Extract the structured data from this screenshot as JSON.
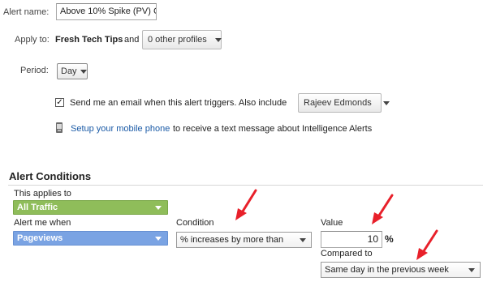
{
  "alert_name": {
    "label": "Alert name:",
    "value": "Above 10% Spike (PV) C"
  },
  "apply_to": {
    "label": "Apply to:",
    "profile": "Fresh Tech Tips",
    "and_text": "and",
    "other_profiles": "0 other profiles"
  },
  "period": {
    "label": "Period:",
    "value": "Day"
  },
  "email": {
    "checked": true,
    "check_glyph": "✓",
    "text": "Send me an email when this alert triggers. Also include",
    "recipient": "Rajeev Edmonds"
  },
  "mobile": {
    "link": "Setup your mobile phone",
    "text": "to receive a text message about Intelligence Alerts",
    "icon": "mobile-phone-icon"
  },
  "conditions": {
    "title": "Alert Conditions",
    "applies_to_label": "This applies to",
    "applies_to_value": "All Traffic",
    "alert_when_label": "Alert me when",
    "alert_when_value": "Pageviews",
    "condition_label": "Condition",
    "condition_value": "% increases by more than",
    "value_label": "Value",
    "value": "10",
    "percent": "%",
    "compared_label": "Compared to",
    "compared_value": "Same day in the previous week"
  },
  "colors": {
    "green_chip": "#8fbd5a",
    "blue_chip": "#7aa3e3",
    "arrow_red": "#e8202a",
    "link": "#1a5aa6"
  }
}
